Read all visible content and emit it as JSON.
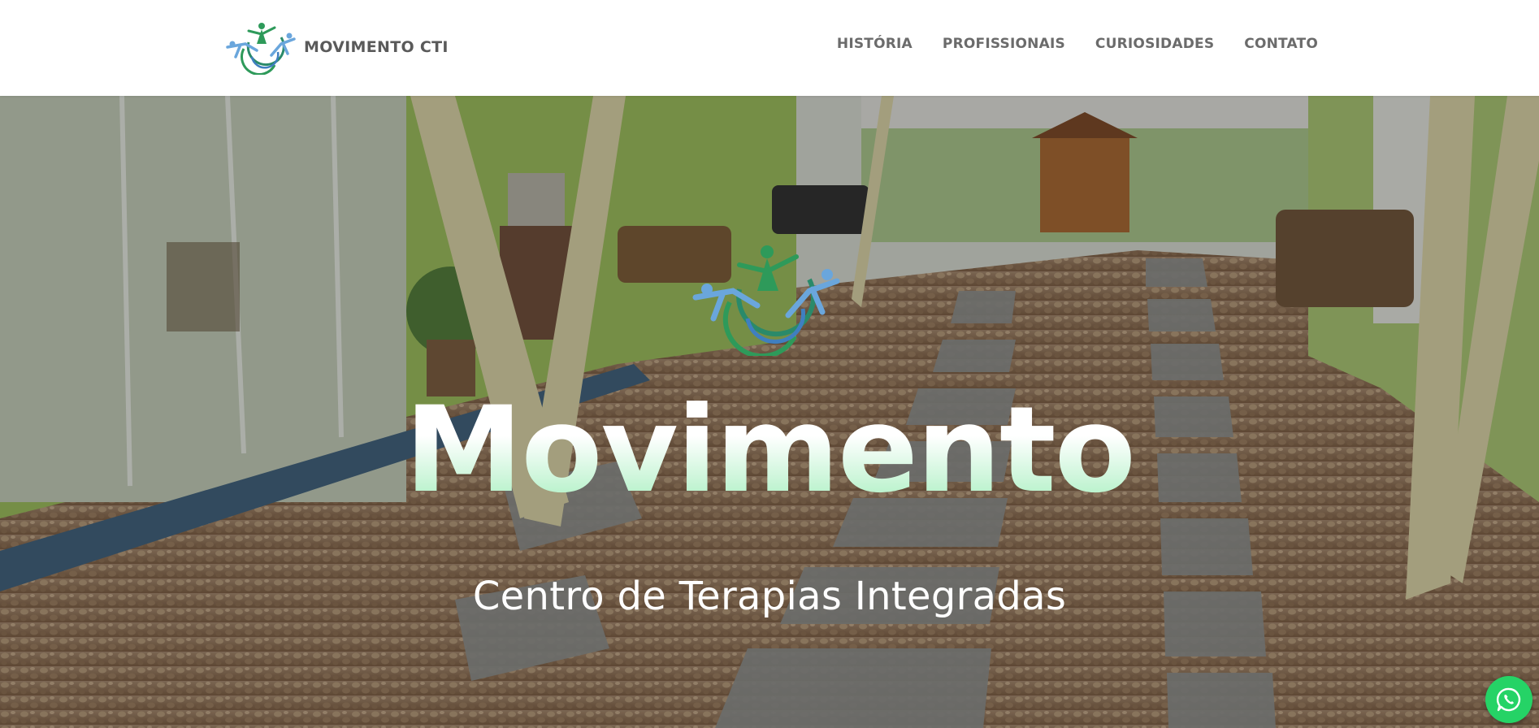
{
  "header": {
    "brand_name": "MOVIMENTO CTI",
    "logo_icon": "movimento-logo-icon",
    "nav": [
      {
        "label": "HISTÓRIA"
      },
      {
        "label": "PROFISSIONAIS"
      },
      {
        "label": "CURIOSIDADES"
      },
      {
        "label": "CONTATO"
      }
    ]
  },
  "hero": {
    "title": "Movimento",
    "subtitle": "Centro de Terapias Integradas",
    "background": "photo of clinic courtyard with green walls, cobblestone floor and wooden hut"
  },
  "floating": {
    "whatsapp_icon": "whatsapp-icon"
  },
  "colors": {
    "brand_green": "#2e9a5a",
    "brand_blue": "#6aa6dc",
    "whatsapp": "#25d366",
    "nav_text": "#6b6b6b"
  }
}
